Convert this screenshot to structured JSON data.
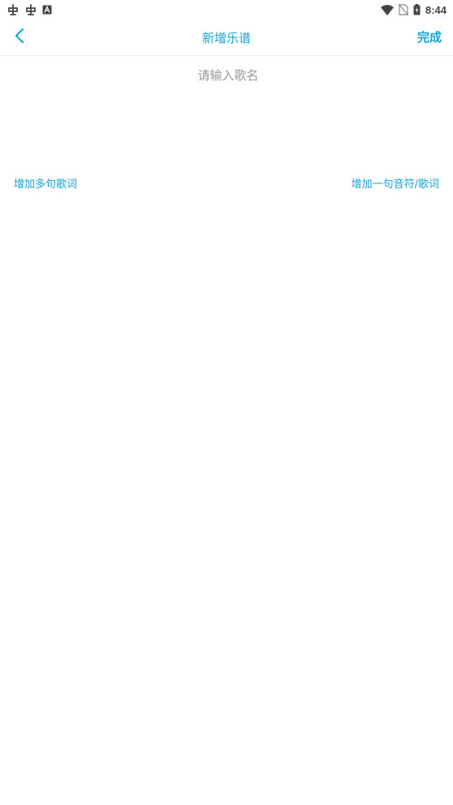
{
  "status_bar": {
    "time": "8:44",
    "left_icons": [
      "bug-icon",
      "bug-icon",
      "font-a-icon"
    ],
    "right_icons": [
      "wifi-icon",
      "no-sim-icon",
      "battery-charging-icon"
    ]
  },
  "toolbar": {
    "title": "新增乐谱",
    "done_label": "完成",
    "back_icon": "chevron-left-icon"
  },
  "song_name": {
    "placeholder": "请输入歌名",
    "value": ""
  },
  "actions": {
    "add_lyrics": "增加多句歌词",
    "add_note_line": "增加一句音符/歌词"
  },
  "colors": {
    "accent": "#1aa3d6",
    "placeholder": "#9a9a9a",
    "divider": "#ececec",
    "status_icons": "#444444"
  }
}
